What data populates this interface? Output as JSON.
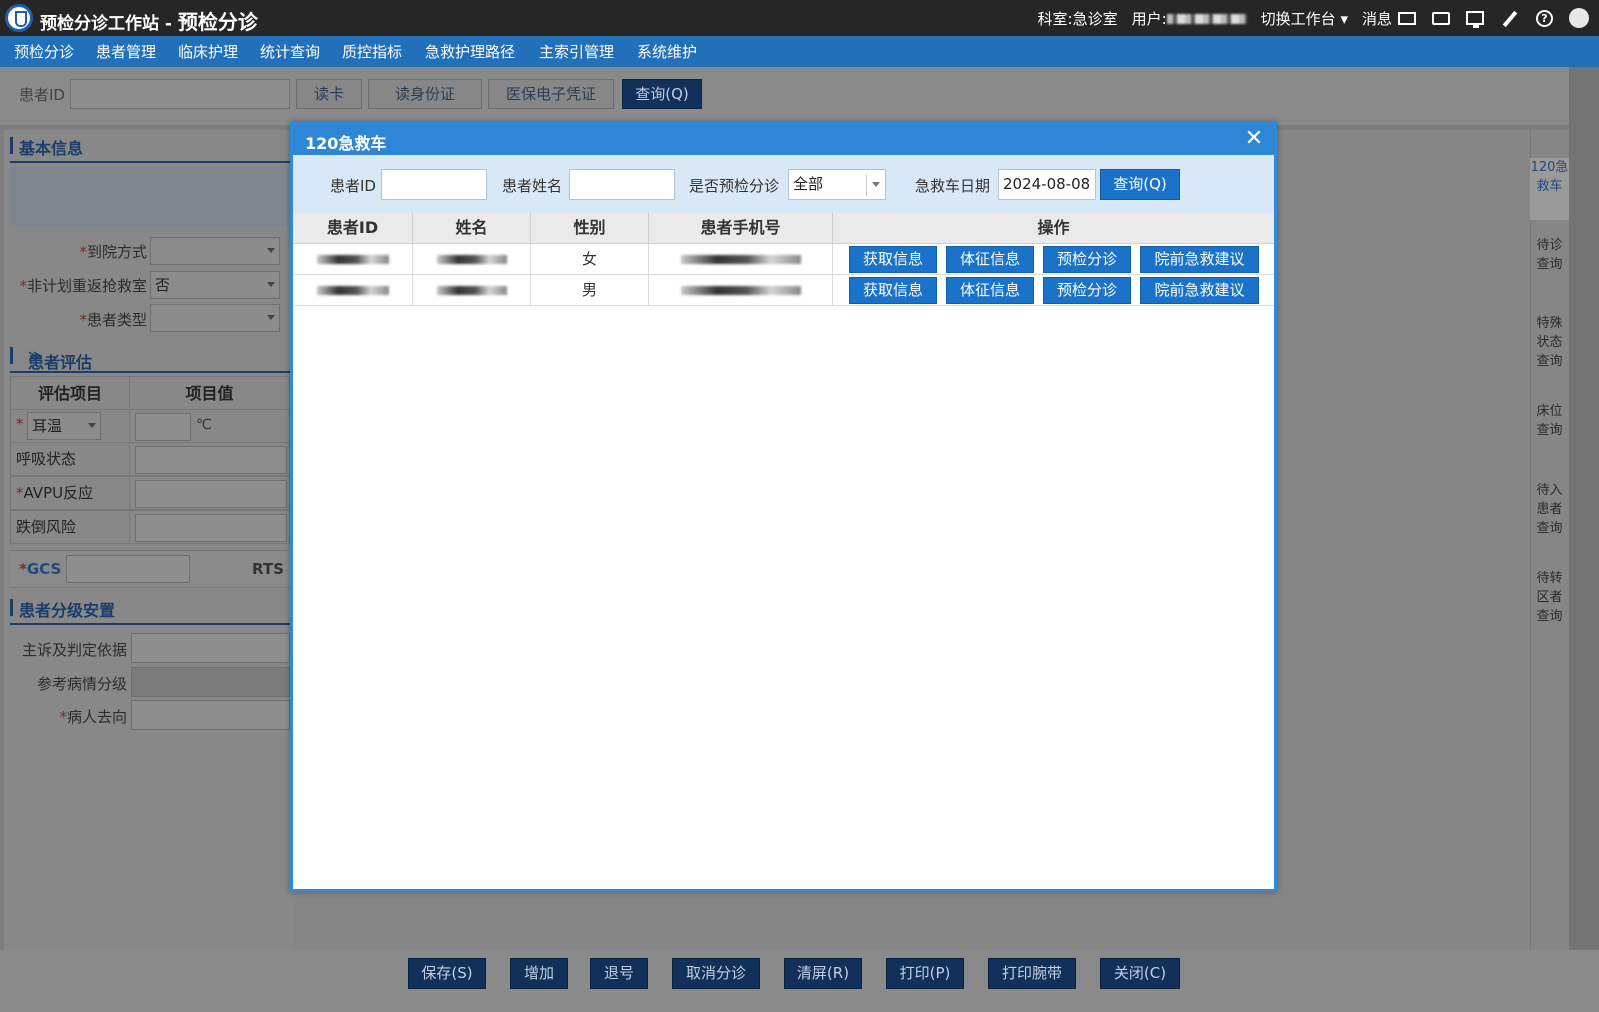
{
  "app": {
    "title_prefix": "预检分诊工作站 - ",
    "title_main": "预检分诊",
    "dept_label": "科室:",
    "dept_value": "急诊室",
    "user_label": "用户:",
    "switch_label": "切换工作台",
    "msg_label": "消息"
  },
  "menu": [
    "预检分诊",
    "患者管理",
    "临床护理",
    "统计查询",
    "质控指标",
    "急救护理路径",
    "主索引管理",
    "系统维护"
  ],
  "search": {
    "patient_id_label": "患者ID",
    "read_card": "读卡",
    "read_id": "读身份证",
    "medical_ins": "医保电子凭证",
    "query": "查询(Q)"
  },
  "left": {
    "basic_info": "基本信息",
    "arrival_label": "到院方式",
    "unplanned_label": "非计划重返抢救室",
    "unplanned_value": "否",
    "patient_type_label": "患者类型",
    "assessment": "患者评估",
    "assess_col1": "评估项目",
    "assess_col2": "项目值",
    "ear_temp": "耳温",
    "temp_unit": "℃",
    "breathing": "呼吸状态",
    "avpu": "AVPU反应",
    "fall_risk": "跌倒风险",
    "gcs": "GCS",
    "rts": "RTS",
    "grading": "患者分级安置",
    "complaint": "主诉及判定依据",
    "ref_level": "参考病情分级",
    "destination": "病人去向"
  },
  "rail": [
    {
      "lines": [
        "120急",
        "救车"
      ]
    },
    {
      "lines": [
        "待诊",
        "查询"
      ]
    },
    {
      "lines": [
        "特殊",
        "状态",
        "查询"
      ]
    },
    {
      "lines": [
        "床位",
        "查询"
      ]
    },
    {
      "lines": [
        "待入",
        "患者",
        "查询"
      ]
    },
    {
      "lines": [
        "待转",
        "区者",
        "查询"
      ]
    }
  ],
  "bottom": [
    "保存(S)",
    "增加",
    "退号",
    "取消分诊",
    "清屏(R)",
    "打印(P)",
    "打印腕带",
    "关闭(C)"
  ],
  "modal": {
    "title": "120急救车",
    "close": "✕",
    "patient_id_label": "患者ID",
    "patient_name_label": "患者姓名",
    "pretriage_label": "是否预检分诊",
    "pretriage_value": "全部",
    "date_label": "急救车日期",
    "date_value": "2024-08-08",
    "query": "查询(Q)",
    "columns": [
      "患者ID",
      "姓名",
      "性别",
      "患者手机号",
      "操作"
    ],
    "rows": [
      {
        "gender": "女"
      },
      {
        "gender": "男"
      }
    ],
    "actions": [
      "获取信息",
      "体征信息",
      "预检分诊",
      "院前急救建议"
    ]
  }
}
